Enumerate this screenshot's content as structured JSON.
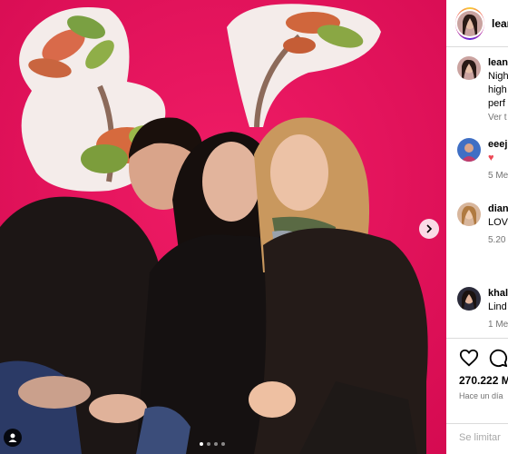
{
  "post": {
    "account": {
      "username": "lean"
    },
    "caption": {
      "username": "lean",
      "lines": [
        "Nigh",
        "high",
        "perf"
      ],
      "see_translation": "Ver t"
    },
    "comments": [
      {
        "username": "eeej",
        "text": "♥",
        "meta": "5 Me"
      },
      {
        "username": "dian",
        "text": "LOV",
        "meta": "5.20"
      },
      {
        "username": "khal",
        "text": "Lind",
        "meta": "1 Me"
      }
    ],
    "likes": "270.222 M",
    "timestamp": "Hace un día",
    "comment_placeholder": "Se limitar",
    "carousel": {
      "slides": 4,
      "active_index": 0
    },
    "colors": {
      "wall": "#e5105a",
      "heart": "#ed4956",
      "story_ring": [
        "#f9ce34",
        "#ee2a7b",
        "#6228d7"
      ]
    },
    "icons": [
      "chevron-right-icon",
      "user-tag-icon",
      "heart-icon",
      "comment-icon"
    ]
  }
}
